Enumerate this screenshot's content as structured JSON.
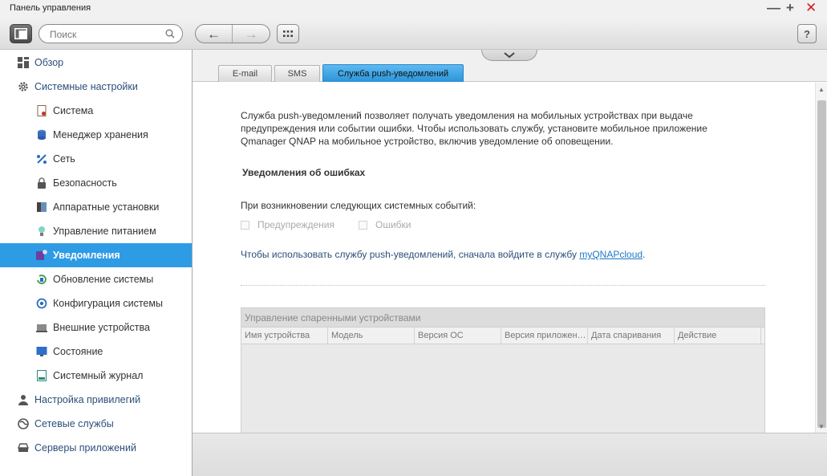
{
  "window": {
    "title": "Панель управления"
  },
  "search": {
    "placeholder": "Поиск"
  },
  "nav": {
    "back": "←",
    "forward": "→"
  },
  "help": {
    "label": "?"
  },
  "sidebar": {
    "items": [
      {
        "label": "Обзор",
        "level": "top",
        "icon": "overview-icon"
      },
      {
        "label": "Системные настройки",
        "level": "top",
        "icon": "gear-icon"
      },
      {
        "label": "Система",
        "level": "sub",
        "icon": "system-icon"
      },
      {
        "label": "Менеджер хранения",
        "level": "sub",
        "icon": "storage-icon"
      },
      {
        "label": "Сеть",
        "level": "sub",
        "icon": "network-icon"
      },
      {
        "label": "Безопасность",
        "level": "sub",
        "icon": "lock-icon"
      },
      {
        "label": "Аппаратные установки",
        "level": "sub",
        "icon": "hardware-icon"
      },
      {
        "label": "Управление питанием",
        "level": "sub",
        "icon": "power-icon"
      },
      {
        "label": "Уведомления",
        "level": "sub",
        "icon": "notification-icon",
        "active": true
      },
      {
        "label": "Обновление системы",
        "level": "sub",
        "icon": "update-icon"
      },
      {
        "label": "Конфигурация системы",
        "level": "sub",
        "icon": "config-icon"
      },
      {
        "label": "Внешние устройства",
        "level": "sub",
        "icon": "external-device-icon"
      },
      {
        "label": "Состояние",
        "level": "sub",
        "icon": "monitor-icon"
      },
      {
        "label": "Системный журнал",
        "level": "sub",
        "icon": "log-icon"
      },
      {
        "label": "Настройка привилегий",
        "level": "top",
        "icon": "user-icon"
      },
      {
        "label": "Сетевые службы",
        "level": "top",
        "icon": "globe-icon"
      },
      {
        "label": "Серверы приложений",
        "level": "top",
        "icon": "server-icon"
      }
    ]
  },
  "tabs": [
    {
      "label": "E-mail"
    },
    {
      "label": "SMS"
    },
    {
      "label": "Служба push-уведомлений",
      "active": true
    }
  ],
  "content": {
    "description": "Служба push-уведомлений позволяет получать уведомления на мобильных устройствах при выдаче предупреждения или событии ошибки. Чтобы использовать службу, установите мобильное приложение Qmanager QNAP на мобильное устройство, включив уведомление об оповещении.",
    "section_title": "Уведомления об ошибках",
    "events_label": "При возникновении следующих системных событий:",
    "checkbox_warnings": "Предупреждения",
    "checkbox_errors": "Ошибки",
    "signin_text": "Чтобы использовать службу push-уведомлений, сначала войдите в службу",
    "signin_link": "myQNAPcloud",
    "signin_suffix": "."
  },
  "paired_devices": {
    "title": "Управление спаренными устройствами",
    "columns": [
      "Имя устройства",
      "Модель",
      "Версия ОС",
      "Версия приложен…",
      "Дата спаривания",
      "Действие"
    ]
  }
}
